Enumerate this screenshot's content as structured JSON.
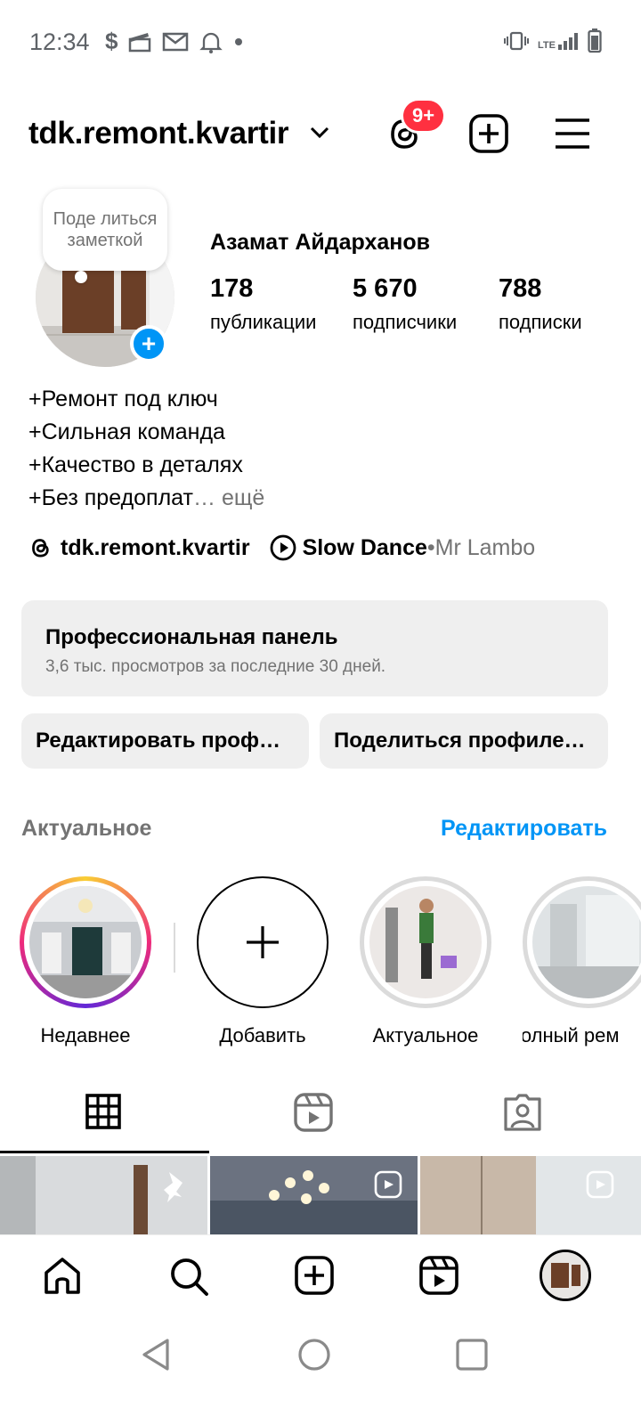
{
  "status_bar": {
    "time": "12:34",
    "left_icons": [
      "dollar-icon",
      "clapper-icon",
      "mail-icon",
      "bell-icon",
      "dot-icon"
    ],
    "right_icons": [
      "vibrate-icon",
      "lte-signal-icon",
      "battery-icon"
    ],
    "network": "LTE"
  },
  "header": {
    "username": "tdk.remont.kvartir",
    "threads_badge": "9+"
  },
  "profile": {
    "note_text": "Поде литься заметкой",
    "full_name": "Азамат Айдарханов",
    "stats": [
      {
        "value": "178",
        "label": "публикации"
      },
      {
        "value": "5 670",
        "label": "подписчики"
      },
      {
        "value": "788",
        "label": "подписки"
      }
    ],
    "bio_lines": [
      "+Ремонт под ключ",
      "+Сильная команда",
      "+Качество в деталях",
      "+Без предоплат"
    ],
    "bio_ellipsis": "…",
    "bio_more": " ещё",
    "threads_handle": "tdk.remont.kvartir",
    "music_title": "Slow Dance",
    "music_separator": " • ",
    "music_artist": "Mr Lambo"
  },
  "pro_panel": {
    "title": "Профессиональная панель",
    "subtitle": "3,6 тыс. просмотров за последние 30 дней."
  },
  "actions": {
    "edit_profile": "Редактировать проф…",
    "share_profile": "Поделиться профиле…"
  },
  "highlights": {
    "title": "Актуальное",
    "edit_label": "Редактировать",
    "items": [
      {
        "label": "Недавнее"
      },
      {
        "label": "Добавить"
      },
      {
        "label": "Актуальное"
      },
      {
        "label": "полный рем"
      }
    ]
  },
  "colors": {
    "accent": "#0095f6",
    "badge": "#ff3040",
    "muted": "#737373",
    "panel": "#efefef"
  }
}
